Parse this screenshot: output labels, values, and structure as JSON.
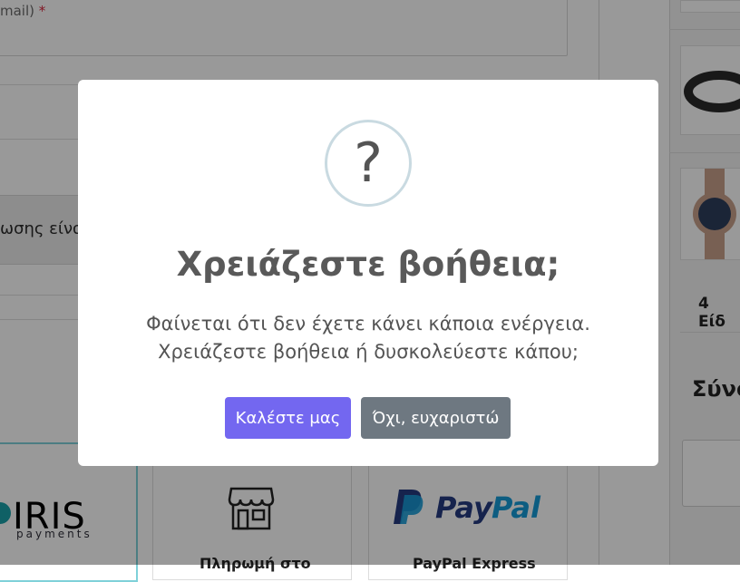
{
  "background": {
    "email_field": {
      "label": "mail)",
      "required_mark": "*"
    },
    "notice_text": "ωσης είναι",
    "payment_methods": [
      {
        "name": "iris-payments",
        "logo_text": "IRIS",
        "logo_sub": "payments"
      },
      {
        "name": "store-pickup",
        "label": "Πληρωμή στο"
      },
      {
        "name": "paypal-express",
        "logo_text": "PayPal",
        "label": "PayPal Express"
      }
    ],
    "sidebar": {
      "items_count": "4 Είδ",
      "total_heading": "Σύνο"
    }
  },
  "modal": {
    "icon": "question-mark-icon",
    "icon_glyph": "?",
    "title": "Χρειάζεστε βοήθεια;",
    "text_line1": "Φαίνεται ότι δεν έχετε κάνει κάποια ενέργεια.",
    "text_line2": "Χρειάζεστε βοήθεια ή δυσκολεύεστε κάπου;",
    "confirm_label": "Καλέστε μας",
    "cancel_label": "Όχι, ευχαριστώ"
  },
  "colors": {
    "confirm_button": "#7367f0",
    "cancel_button": "#6e7881",
    "icon_ring": "#c9dae1",
    "overlay": "rgba(0,0,0,0.4)"
  }
}
